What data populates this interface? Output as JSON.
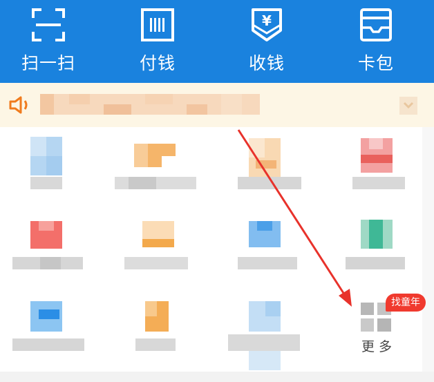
{
  "top_actions": [
    {
      "label": "扫一扫",
      "icon": "scan-icon"
    },
    {
      "label": "付钱",
      "icon": "pay-icon"
    },
    {
      "label": "收钱",
      "icon": "receive-money-icon"
    },
    {
      "label": "卡包",
      "icon": "card-wallet-icon"
    }
  ],
  "notice": {
    "icon": "speaker-icon",
    "close_icon": "collapse-icon"
  },
  "more": {
    "label": "更多",
    "badge": "找童年",
    "icon": "grid-more-icon"
  },
  "colors": {
    "brand_blue": "#1a82de",
    "notice_bg": "#fdf6e5",
    "badge_red": "#f03a2e",
    "arrow_red": "#e8322b"
  }
}
